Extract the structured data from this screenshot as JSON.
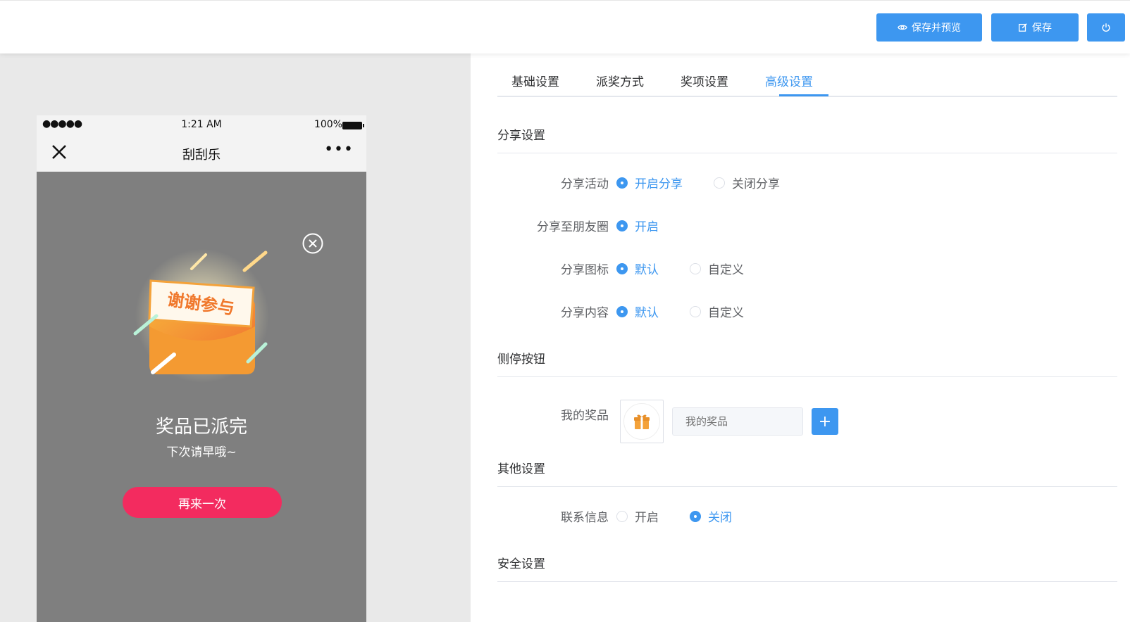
{
  "toolbar": {
    "save_preview_label": "保存并预览",
    "save_label": "保存"
  },
  "phone": {
    "status_dots": "●●●●●",
    "time": "1:21 AM",
    "battery": "100%",
    "nav_title": "刮刮乐",
    "nav_more": "•••",
    "card_text": "谢谢参与",
    "result_title": "奖品已派完",
    "result_subtitle": "下次请早哦~",
    "again_button": "再来一次"
  },
  "tabs": [
    {
      "label": "基础设置",
      "active": false
    },
    {
      "label": "派奖方式",
      "active": false
    },
    {
      "label": "奖项设置",
      "active": false
    },
    {
      "label": "高级设置",
      "active": true
    }
  ],
  "sections": {
    "share": "分享设置",
    "side": "侧停按钮",
    "other": "其他设置",
    "security": "安全设置"
  },
  "share": {
    "activity_label": "分享活动",
    "activity_on": "开启分享",
    "activity_off": "关闭分享",
    "moments_label": "分享至朋友圈",
    "moments_on": "开启",
    "icon_label": "分享图标",
    "icon_default": "默认",
    "icon_custom": "自定义",
    "content_label": "分享内容",
    "content_default": "默认",
    "content_custom": "自定义"
  },
  "side": {
    "my_prize_label": "我的奖品",
    "my_prize_placeholder": "我的奖品",
    "plus": "+"
  },
  "other": {
    "contact_label": "联系信息",
    "contact_on": "开启",
    "contact_off": "关闭"
  },
  "colors": {
    "primary": "#3d97f0",
    "again_button": "#f32b5f",
    "phone_overlay": "#7f7f7f"
  }
}
